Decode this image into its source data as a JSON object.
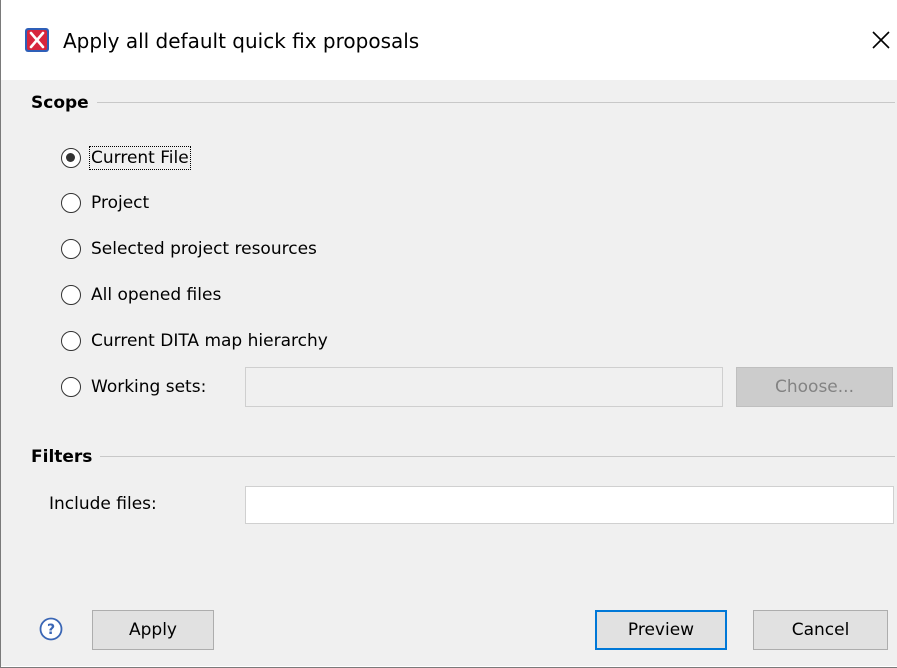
{
  "window": {
    "title": "Apply all default quick fix proposals",
    "app_icon": "oxygen-x-logo-icon",
    "close_icon": "close-icon"
  },
  "scope": {
    "title": "Scope",
    "options": [
      {
        "label": "Current File",
        "checked": true
      },
      {
        "label": "Project",
        "checked": false
      },
      {
        "label": "Selected project resources",
        "checked": false
      },
      {
        "label": "All opened files",
        "checked": false
      },
      {
        "label": "Current DITA map hierarchy",
        "checked": false
      },
      {
        "label": "Working sets:",
        "checked": false
      }
    ],
    "working_sets_value": "",
    "choose_label": "Choose..."
  },
  "filters": {
    "title": "Filters",
    "include_label": "Include files:",
    "include_value": ""
  },
  "buttons": {
    "help_icon": "help-icon",
    "apply": "Apply",
    "preview": "Preview",
    "cancel": "Cancel"
  },
  "colors": {
    "background": "#f0f0f0",
    "default_button_border": "#0078d7",
    "app_icon": "#d7263d"
  }
}
